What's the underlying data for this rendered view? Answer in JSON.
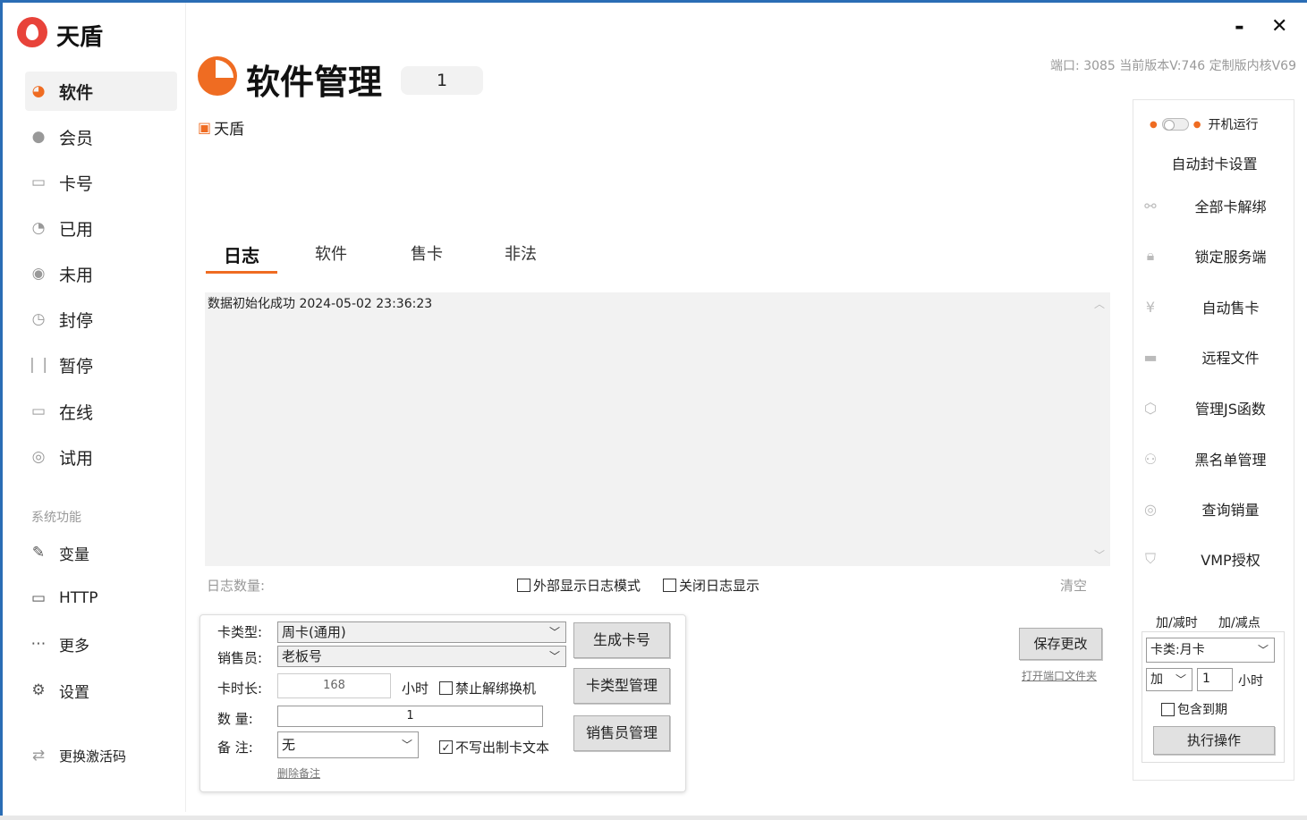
{
  "window": {
    "title": "天盾",
    "minimize_label": "-",
    "close_label": "✕"
  },
  "sidebar": {
    "items": [
      {
        "label": "软件",
        "icon": "pie-icon"
      },
      {
        "label": "会员",
        "icon": "crown-icon"
      },
      {
        "label": "卡号",
        "icon": "card-icon"
      },
      {
        "label": "已用",
        "icon": "clock-used-icon"
      },
      {
        "label": "未用",
        "icon": "radio-icon"
      },
      {
        "label": "封停",
        "icon": "clock-icon"
      },
      {
        "label": "暂停",
        "icon": "pause-icon"
      },
      {
        "label": "在线",
        "icon": "monitor-icon"
      },
      {
        "label": "试用",
        "icon": "trial-icon"
      }
    ],
    "section_title": "系统功能",
    "system_items": [
      {
        "label": "变量",
        "icon": "edit-icon"
      },
      {
        "label": "HTTP",
        "icon": "monitor-icon"
      },
      {
        "label": "更多",
        "icon": "more-icon"
      },
      {
        "label": "设置",
        "icon": "gear-icon"
      }
    ],
    "change_code_label": "更换激活码"
  },
  "header": {
    "title": "软件管理",
    "count": "1",
    "meta": "端口: 3085  当前版本V:746 定制版内核V69",
    "software_name": "天盾"
  },
  "tabs": [
    {
      "label": "日志",
      "active": true
    },
    {
      "label": "软件",
      "active": false
    },
    {
      "label": "售卡",
      "active": false
    },
    {
      "label": "非法",
      "active": false
    }
  ],
  "log": {
    "lines": [
      "数据初始化成功  2024-05-02 23:36:23"
    ],
    "count_label": "日志数量:",
    "external_mode_label": "外部显示日志模式",
    "close_display_label": "关闭日志显示",
    "clear_label": "清空"
  },
  "card_form": {
    "card_type_label": "卡类型:",
    "card_type_value": "周卡(通用)",
    "seller_label": "销售员:",
    "seller_value": "老板号",
    "duration_label": "卡时长:",
    "duration_value": "168",
    "duration_unit": "小时",
    "forbid_unbind_label": "禁止解绑换机",
    "quantity_label": "数  量:",
    "quantity_value": "1",
    "note_label": "备  注:",
    "note_value": "无",
    "no_write_text_label": "不写出制卡文本",
    "delete_note_label": "删除备注",
    "generate_button": "生成卡号",
    "card_type_manage_button": "卡类型管理",
    "seller_manage_button": "销售员管理"
  },
  "save": {
    "button": "保存更改",
    "open_port_file": "打开端口文件夹"
  },
  "right_panel": {
    "autostart_label": "开机运行",
    "auto_ban_label": "自动封卡设置",
    "items": [
      {
        "label": "全部卡解绑",
        "icon": "link-icon"
      },
      {
        "label": "锁定服务端",
        "icon": "lock-icon"
      },
      {
        "label": "自动售卡",
        "icon": "yen-icon"
      },
      {
        "label": "远程文件",
        "icon": "folder-icon"
      },
      {
        "label": "管理JS函数",
        "icon": "js-icon"
      },
      {
        "label": "黑名单管理",
        "icon": "user-ban-icon"
      },
      {
        "label": "查询销量",
        "icon": "search-icon"
      },
      {
        "label": "VMP授权",
        "icon": "shield-icon"
      }
    ],
    "tab_time": "加/减时",
    "tab_point": "加/减点",
    "card_select": "卡类:月卡",
    "op_select": "加",
    "amount": "1",
    "unit": "小时",
    "include_expired_label": "包含到期",
    "execute_button": "执行操作"
  },
  "colors": {
    "accent": "#ef6c22",
    "border": "#2a6db5"
  }
}
